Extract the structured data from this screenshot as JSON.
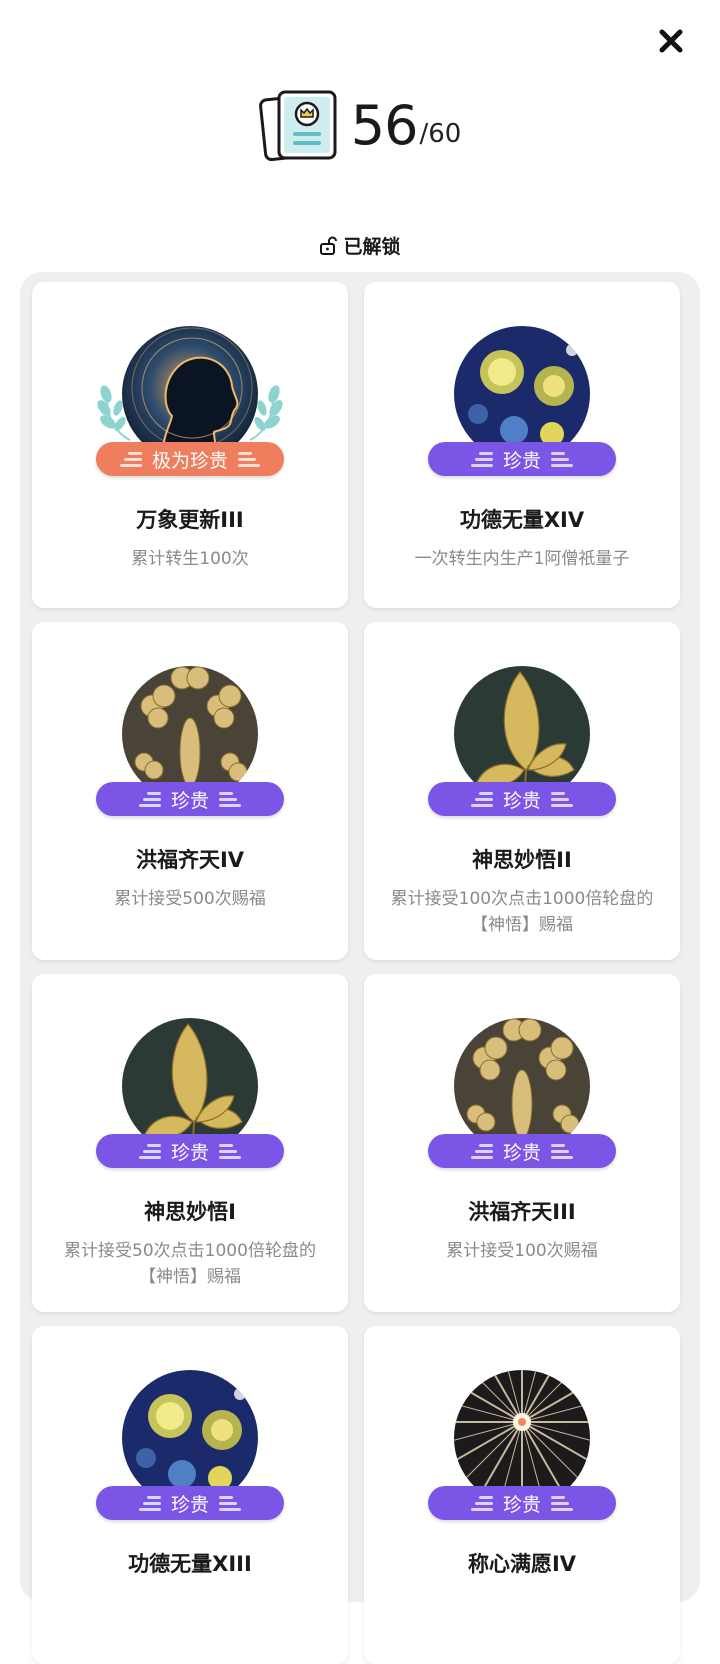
{
  "header": {
    "count": "56",
    "total": "/60"
  },
  "status": {
    "label": "已解锁"
  },
  "colors": {
    "rare": "#7a55e6",
    "epic": "#ef7e5e",
    "panel": "#efefef"
  },
  "achievements": [
    {
      "title": "万象更新III",
      "desc": "累计转生100次",
      "rarity": "极为珍贵",
      "art": "head"
    },
    {
      "title": "功德无量XIV",
      "desc": "一次转生内生产1阿僧祇量子",
      "rarity": "珍贵",
      "art": "starry"
    },
    {
      "title": "洪福齐天IV",
      "desc": "累计接受500次赐福",
      "rarity": "珍贵",
      "art": "clover"
    },
    {
      "title": "神思妙悟II",
      "desc": "累计接受100次点击1000倍轮盘的【神悟】赐福",
      "rarity": "珍贵",
      "art": "leaf"
    },
    {
      "title": "神思妙悟I",
      "desc": "累计接受50次点击1000倍轮盘的【神悟】赐福",
      "rarity": "珍贵",
      "art": "leaf"
    },
    {
      "title": "洪福齐天III",
      "desc": "累计接受100次赐福",
      "rarity": "珍贵",
      "art": "clover"
    },
    {
      "title": "功德无量XIII",
      "desc": "",
      "rarity": "珍贵",
      "art": "starry"
    },
    {
      "title": "称心满愿IV",
      "desc": "",
      "rarity": "珍贵",
      "art": "burst"
    }
  ]
}
